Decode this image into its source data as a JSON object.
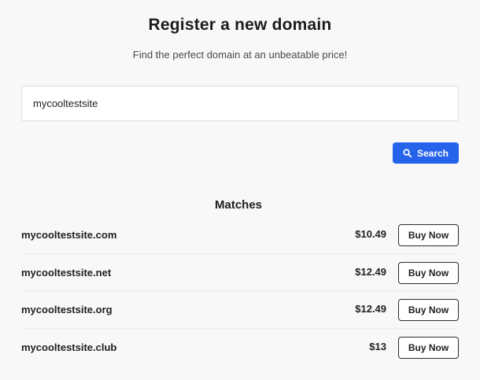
{
  "header": {
    "title": "Register a new domain",
    "subtitle": "Find the perfect domain at an unbeatable price!"
  },
  "search": {
    "value": "mycooltestsite",
    "placeholder": "",
    "button_label": "Search",
    "button_icon": "search-icon",
    "button_color": "#2563eb"
  },
  "matches": {
    "heading": "Matches",
    "items": [
      {
        "domain": "mycooltestsite.com",
        "price": "$10.49",
        "action_label": "Buy Now"
      },
      {
        "domain": "mycooltestsite.net",
        "price": "$12.49",
        "action_label": "Buy Now"
      },
      {
        "domain": "mycooltestsite.org",
        "price": "$12.49",
        "action_label": "Buy Now"
      },
      {
        "domain": "mycooltestsite.club",
        "price": "$13",
        "action_label": "Buy Now"
      }
    ]
  }
}
